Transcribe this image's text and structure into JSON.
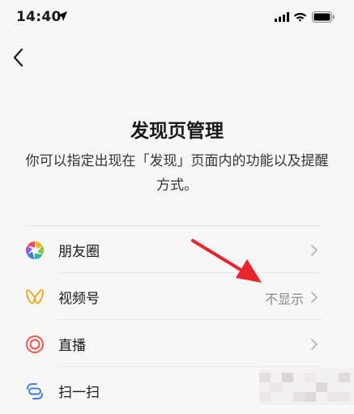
{
  "status_bar": {
    "time": "14:40"
  },
  "page": {
    "title": "发现页管理",
    "description": "你可以指定出现在「发现」页面内的功能以及提醒方式。"
  },
  "list": {
    "items": [
      {
        "label": "朋友圈",
        "value": "",
        "icon": "moments-icon"
      },
      {
        "label": "视频号",
        "value": "不显示",
        "icon": "channels-icon"
      },
      {
        "label": "直播",
        "value": "",
        "icon": "live-icon"
      },
      {
        "label": "扫一扫",
        "value": "",
        "icon": "scan-icon"
      }
    ]
  },
  "annotation": {
    "arrow_color": "#e8242c"
  }
}
